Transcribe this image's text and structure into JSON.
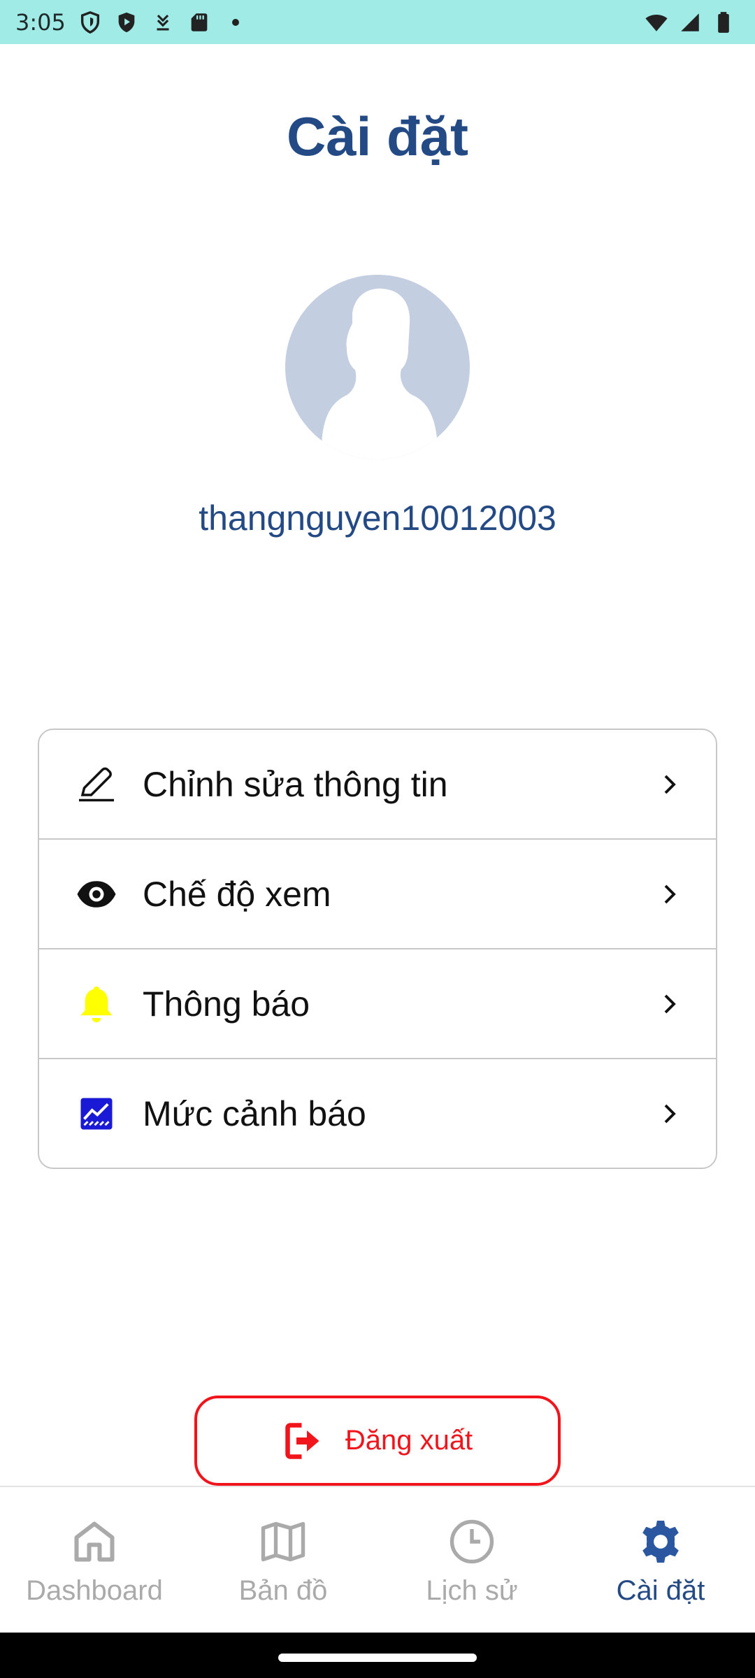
{
  "status_bar": {
    "time": "3:05",
    "background": "#a0ebe6",
    "left_icons": [
      "shield-icon",
      "play-shield-icon",
      "download-icon",
      "sd-card-icon",
      "dot-icon"
    ],
    "right_icons": [
      "wifi-icon",
      "signal-icon",
      "battery-icon"
    ]
  },
  "header": {
    "title": "Cài đặt",
    "title_color": "#244a86"
  },
  "profile": {
    "avatar_icon": "default-avatar-icon",
    "username": "thangnguyen10012003"
  },
  "settings": {
    "items": [
      {
        "label": "Chỉnh sửa thông tin",
        "icon": "pencil-icon",
        "icon_color": "#111111"
      },
      {
        "label": "Chế độ xem",
        "icon": "eye-icon",
        "icon_color": "#111111"
      },
      {
        "label": "Thông báo",
        "icon": "bell-icon",
        "icon_color": "#ffff00"
      },
      {
        "label": "Mức cảnh báo",
        "icon": "chart-icon",
        "icon_color": "#1a1ad6"
      }
    ]
  },
  "logout": {
    "label": "Đăng xuất",
    "icon": "logout-icon",
    "color": "#f2141b"
  },
  "bottom_nav": {
    "active_color": "#244a86",
    "inactive_color": "#aaaaaa",
    "items": [
      {
        "label": "Dashboard",
        "icon": "home-icon",
        "active": false
      },
      {
        "label": "Bản đồ",
        "icon": "map-icon",
        "active": false
      },
      {
        "label": "Lịch sử",
        "icon": "clock-icon",
        "active": false
      },
      {
        "label": "Cài đặt",
        "icon": "gear-icon",
        "active": true
      }
    ]
  }
}
